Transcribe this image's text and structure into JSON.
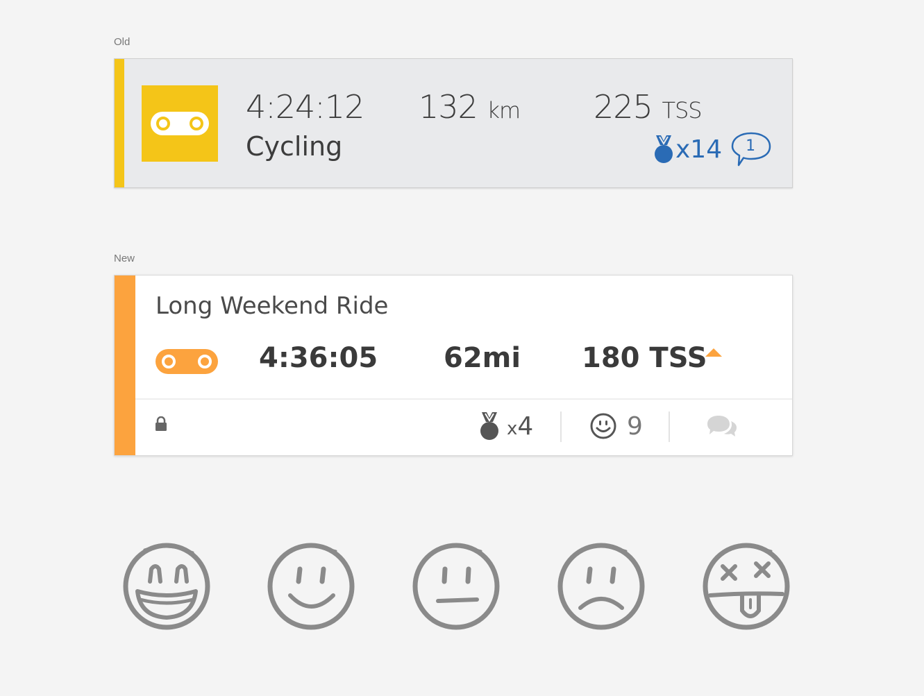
{
  "sections": {
    "old_label": "Old",
    "new_label": "New"
  },
  "old_card": {
    "duration": "4:24:12",
    "sport": "Cycling",
    "distance": "132",
    "distance_unit": "km",
    "tss": "225",
    "tss_unit": "TSS",
    "medals": "x14",
    "comments": "1",
    "colors": {
      "accent": "#f4c518",
      "link": "#2a6bb5"
    }
  },
  "new_card": {
    "title": "Long Weekend Ride",
    "duration": "4:36:05",
    "distance": "62mi",
    "tss": "180 TSS",
    "medals_x": "x",
    "medals_count": "4",
    "likes": "9",
    "colors": {
      "accent": "#fca33e"
    }
  },
  "feelings": {
    "icons": [
      "grinning-face-icon",
      "smiling-face-icon",
      "neutral-face-icon",
      "frowning-face-icon",
      "dizzy-tongue-face-icon"
    ]
  }
}
